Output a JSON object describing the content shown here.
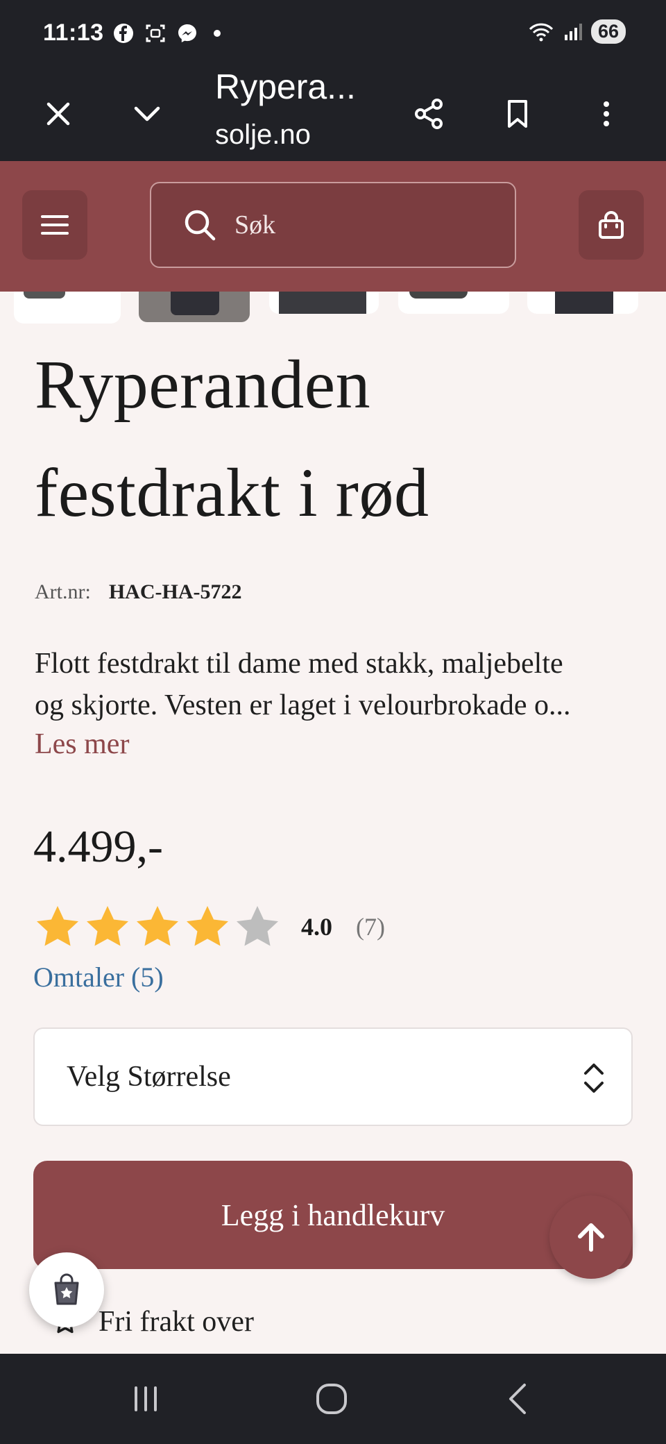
{
  "status_bar": {
    "time": "11:13",
    "battery": "66"
  },
  "browser": {
    "title": "Rypera...",
    "url": "solje.no"
  },
  "header": {
    "search_placeholder": "Søk"
  },
  "product": {
    "title_line1": "Ryperanden",
    "title_line2": "festdrakt i rød",
    "art_label": "Art.nr:",
    "art_value": "HAC-HA-5722",
    "description_line1": "Flott festdrakt til dame med stakk, maljebelte",
    "description_line2": "og skjorte. Vesten er laget i velourbrokade o...",
    "read_more": "Les mer",
    "price": "4.499,-",
    "rating_value": "4.0",
    "rating_count": "(7)",
    "rating_stars": 4,
    "rating_max": 5,
    "reviews_link": "Omtaler (5)",
    "size_select": "Velg Størrelse",
    "add_to_cart": "Legg i handlekurv",
    "shipping_text": "Fri frakt over"
  },
  "colors": {
    "brand": "#8d474a",
    "star_filled": "#fbb735",
    "star_empty": "#bdbdbd",
    "link": "#3a6f9e"
  }
}
